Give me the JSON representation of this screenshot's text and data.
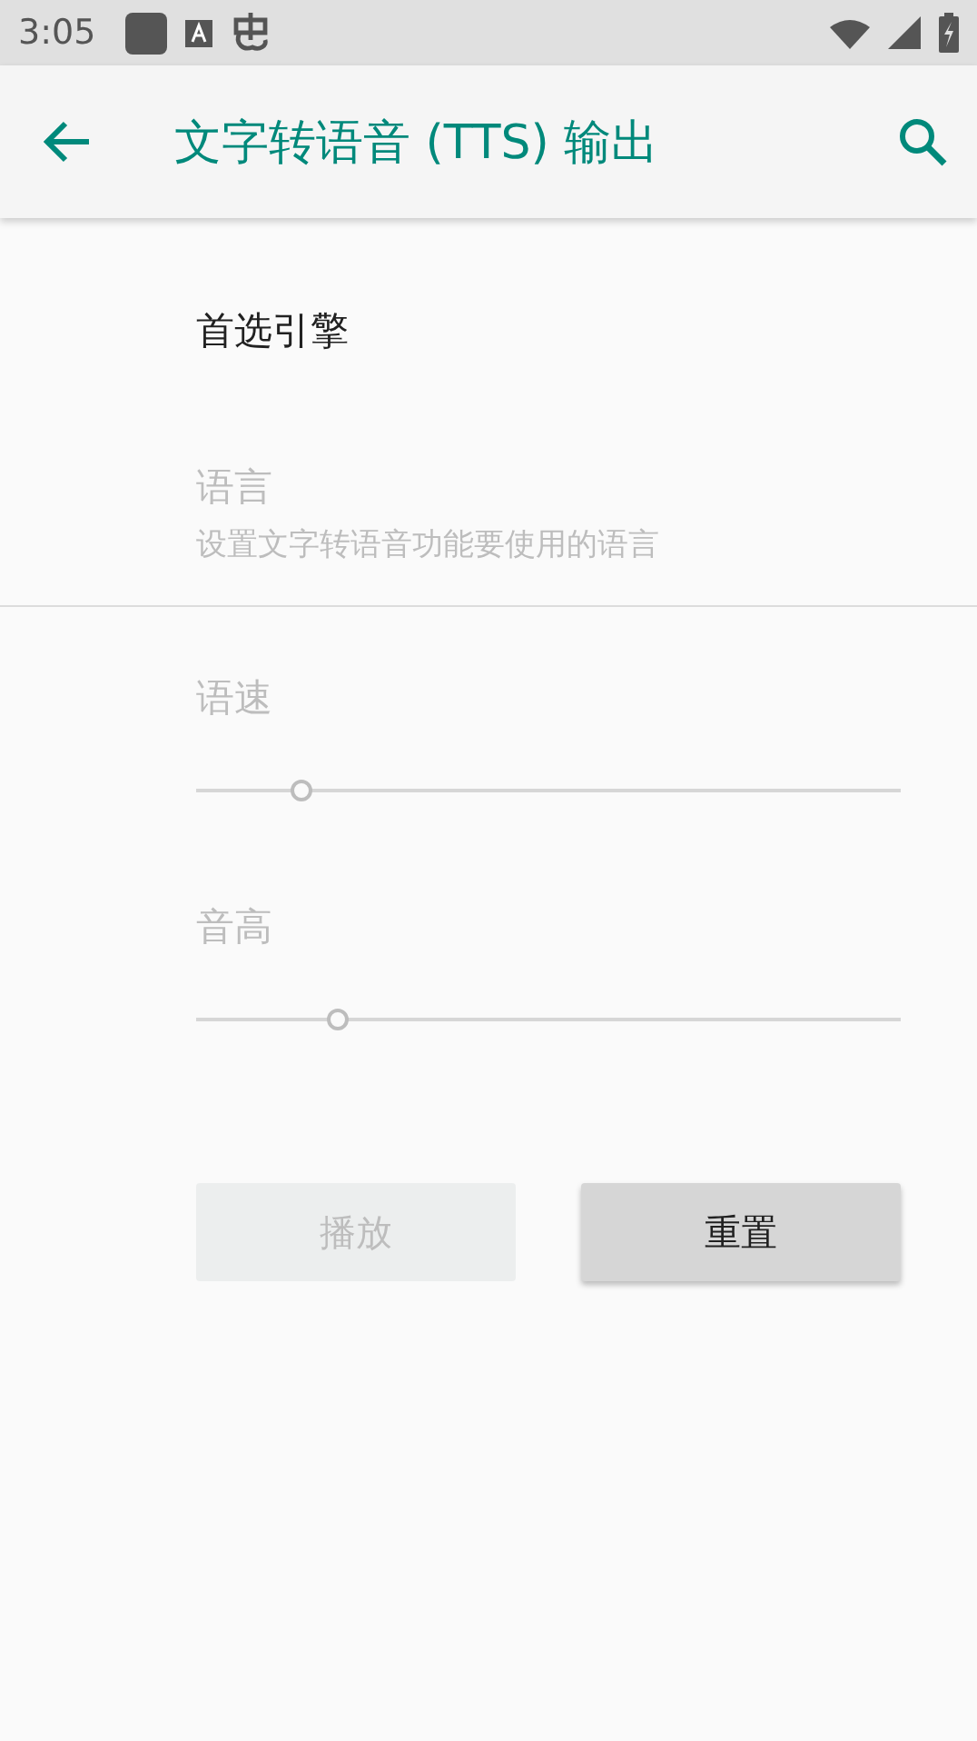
{
  "status_bar": {
    "time": "3:05"
  },
  "app_bar": {
    "title": "文字转语音 (TTS) 输出"
  },
  "preferences": [
    {
      "kind": "text",
      "title": "首选引擎",
      "disabled": false
    },
    {
      "kind": "text",
      "title": "语言",
      "summary": "设置文字转语音功能要使用的语言",
      "disabled": true
    },
    {
      "kind": "divider"
    },
    {
      "kind": "slider",
      "title": "语速",
      "level": 0.15,
      "disabled": true
    },
    {
      "kind": "slider",
      "title": "音高",
      "level": 0.2,
      "disabled": true
    }
  ],
  "buttons": [
    {
      "label": "播放",
      "disabled": true
    },
    {
      "label": "重置",
      "disabled": false
    }
  ]
}
